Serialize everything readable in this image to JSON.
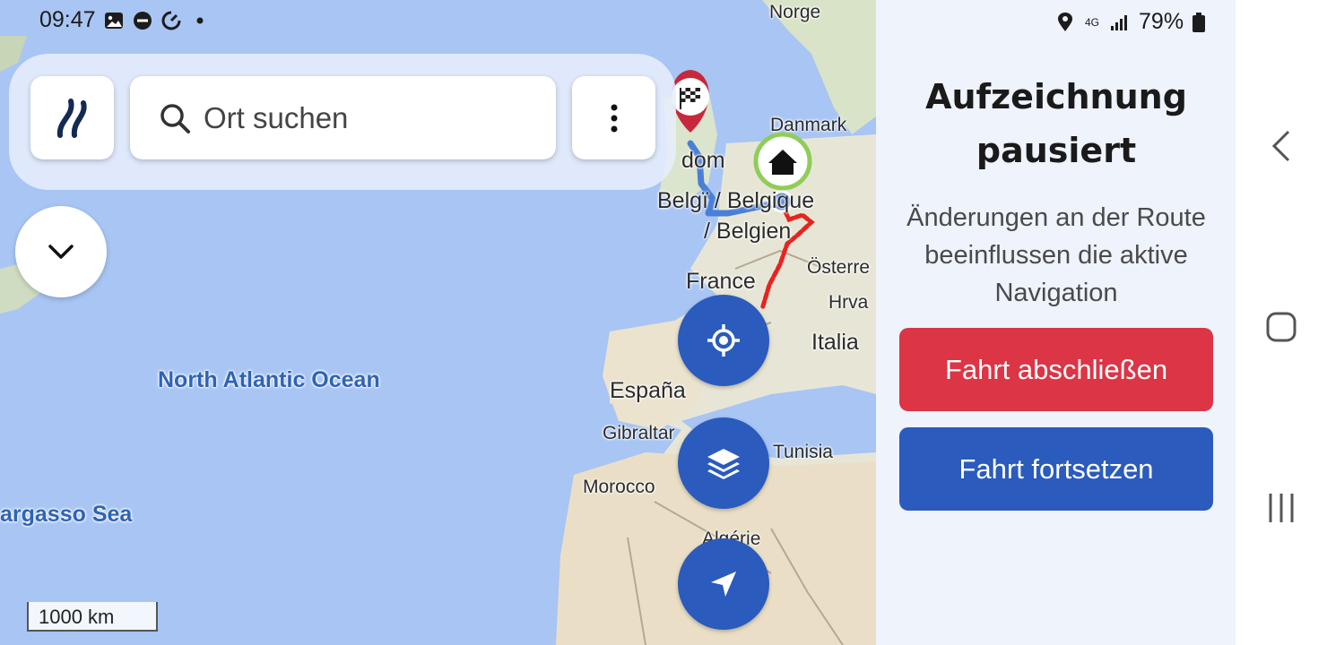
{
  "status_bar": {
    "time": "09:47",
    "battery": "79%",
    "network": "4G",
    "left_icons": [
      "gallery-icon",
      "do-not-disturb-icon",
      "sync-icon",
      "dot-icon"
    ],
    "right_icons": [
      "location-icon",
      "network-4g-icon",
      "signal-icon",
      "battery-icon"
    ]
  },
  "search": {
    "placeholder": "Ort suchen"
  },
  "map": {
    "labels": {
      "ocean": "North Atlantic Ocean",
      "sargasso": "argasso Sea",
      "norge": "Norge",
      "danmark": "Danmark",
      "kingdom": "dom",
      "belgie": "Belgï / Belgique",
      "belgien": "/ Belgien",
      "osterreich": "Österre",
      "france": "France",
      "hrvatska": "Hrva",
      "italia": "Italia",
      "espana": "España",
      "gibraltar": "Gibraltar",
      "tunisia": "Tunisia",
      "morocco": "Morocco",
      "algerie": "Algérie"
    },
    "scale": "1000 km",
    "colors": {
      "ocean": "#a8c5f4",
      "route_blue": "#4a7fd6",
      "track_red": "#e8231f",
      "destination_pin": "#c7283c",
      "home_marker_ring": "#8fcd58"
    }
  },
  "panel": {
    "title": "Aufzeichnung pausiert",
    "text": "Änderungen an der Route beeinflussen die aktive Navigation",
    "finish_button": "Fahrt abschließen",
    "continue_button": "Fahrt fortsetzen"
  },
  "colors": {
    "primary": "#2a5bbd",
    "danger": "#dc3545",
    "panel_bg": "#eef3fc"
  }
}
